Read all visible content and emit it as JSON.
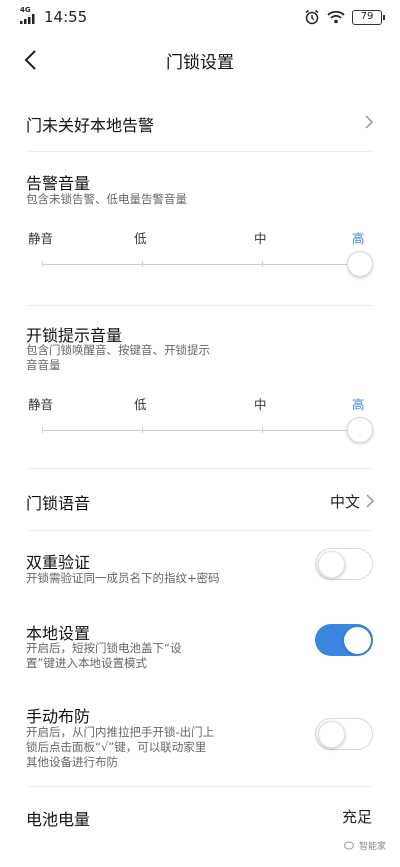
{
  "status_bar": {
    "network": "4G",
    "time": "14:55",
    "battery": "79"
  },
  "header": {
    "title": "门锁设置"
  },
  "alarm_row": {
    "label": "门未关好本地告警"
  },
  "alarm_volume": {
    "title": "告警音量",
    "description": "包含未锁告警、低电量告警音量",
    "levels": [
      "静音",
      "低",
      "中",
      "高"
    ],
    "selected": "高"
  },
  "unlock_volume": {
    "title": "开锁提示音量",
    "description_line1": "包含门锁唤醒音、按键音、开锁提示",
    "description_line2": "音音量",
    "levels": [
      "静音",
      "低",
      "中",
      "高"
    ],
    "selected": "高"
  },
  "voice_row": {
    "label": "门锁语音",
    "value": "中文"
  },
  "dual_verify": {
    "title": "双重验证",
    "description": "开锁需验证同一成员名下的指纹+密码",
    "enabled": false
  },
  "local_settings": {
    "title": "本地设置",
    "description_line1": "开启后，短按门锁电池盖下“设",
    "description_line2": "置”键进入本地设置模式",
    "enabled": true
  },
  "manual_arm": {
    "title": "手动布防",
    "description_line1": "开启后，从门内推拉把手开锁-出门上",
    "description_line2": "锁后点击面板“√”键，可以联动家里",
    "description_line3": "其他设备进行布防",
    "enabled": false
  },
  "battery_row": {
    "label": "电池电量",
    "value": "充足"
  },
  "watermark": {
    "text": "智能家"
  },
  "colors": {
    "accent": "#3a87e0",
    "divider": "#ececec"
  }
}
